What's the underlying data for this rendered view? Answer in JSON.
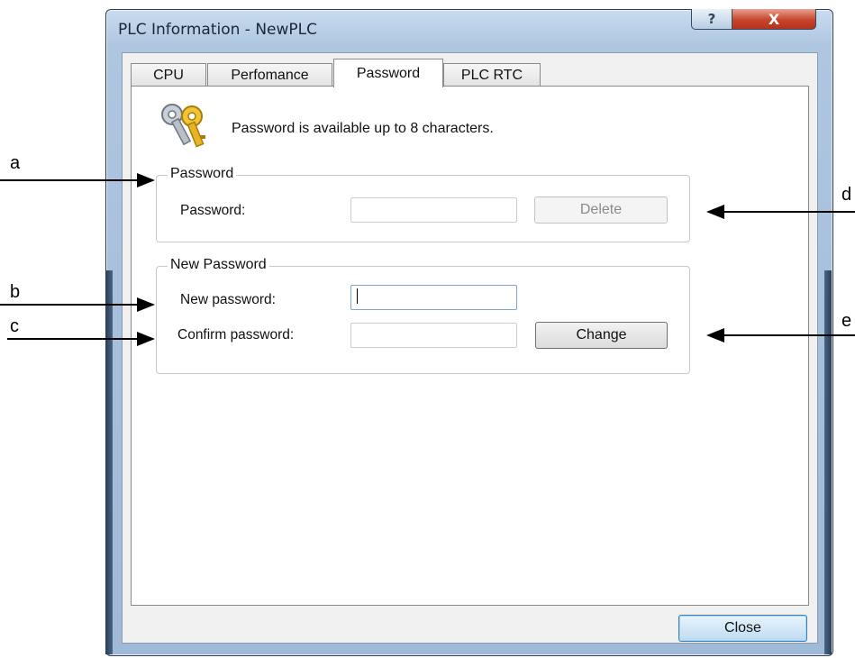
{
  "window": {
    "title": "PLC Information - NewPLC",
    "help_label": "?",
    "close_label": "X"
  },
  "tabs": [
    {
      "label": "CPU",
      "active": false
    },
    {
      "label": "Perfomance",
      "active": false
    },
    {
      "label": "Password",
      "active": true
    },
    {
      "label": "PLC RTC",
      "active": false
    }
  ],
  "info": {
    "icon": "keys-icon",
    "text": "Password is available up to 8 characters."
  },
  "password_group": {
    "title": "Password",
    "password_label": "Password:",
    "password_value": "",
    "delete_label": "Delete",
    "delete_enabled": false
  },
  "new_password_group": {
    "title": "New Password",
    "new_label": "New password:",
    "new_value": "",
    "confirm_label": "Confirm password:",
    "confirm_value": "",
    "change_label": "Change"
  },
  "footer": {
    "close_label": "Close"
  },
  "annotations": {
    "a": "a",
    "b": "b",
    "c": "c",
    "d": "d",
    "e": "e"
  },
  "colors": {
    "close_caption": "#c6452c",
    "default_button": "#bedbf2",
    "frame": "#aec6e0"
  }
}
